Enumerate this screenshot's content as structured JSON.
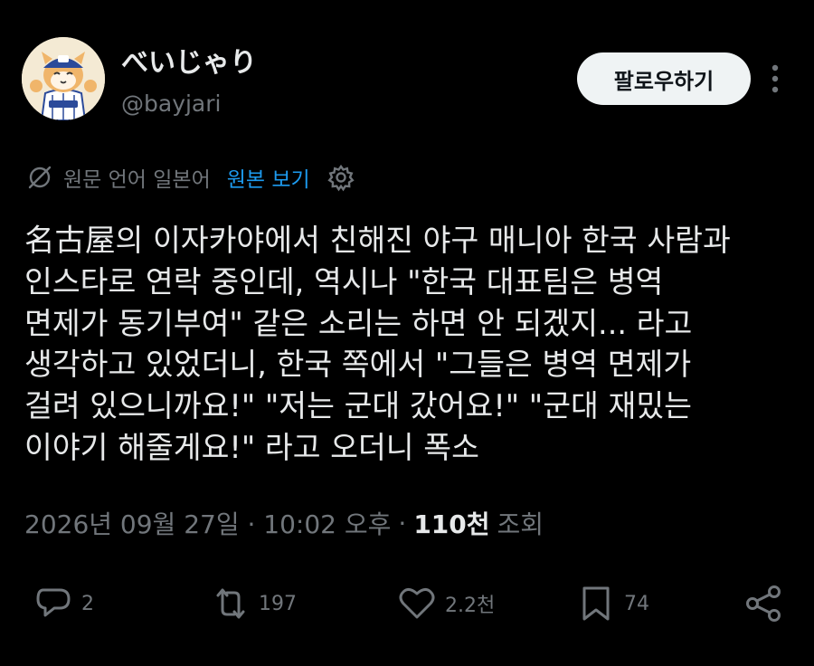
{
  "author": {
    "display_name": "べいじゃり",
    "handle": "@bayjari"
  },
  "follow_button_label": "팔로우하기",
  "translation": {
    "source_language_text": "원문 언어 일본어",
    "show_original_label": "원본 보기"
  },
  "tweet_lines": [
    "名古屋의 이자카야에서 친해진 야구 매니아 한국 사람과",
    "인스타로 연락 중인데, 역시나 \"한국 대표팀은 병역",
    "면제가 동기부여\" 같은 소리는 하면 안 되겠지... 라고",
    "생각하고 있었더니, 한국 쪽에서 \"그들은 병역 면제가",
    "걸려 있으니까요!\" \"저는 군대 갔어요!\" \"군대 재밌는",
    "이야기 해줄게요!\" 라고 오더니 폭소"
  ],
  "meta": {
    "timestamp": "2026년 09월 27일 · 10:02 오후",
    "separator": "·",
    "views_count": "110천",
    "views_label": "조회"
  },
  "actions": {
    "replies": "2",
    "reposts": "197",
    "likes": "2.2천",
    "bookmarks": "74"
  },
  "colors": {
    "background": "#000000",
    "text": "#e7e9ea",
    "muted": "#71767b",
    "link": "#1d9bf0",
    "button_bg": "#eff3f4"
  },
  "icons": [
    "translate-icon",
    "settings-icon",
    "more-icon",
    "reply-icon",
    "repost-icon",
    "like-icon",
    "bookmark-icon",
    "share-icon"
  ]
}
